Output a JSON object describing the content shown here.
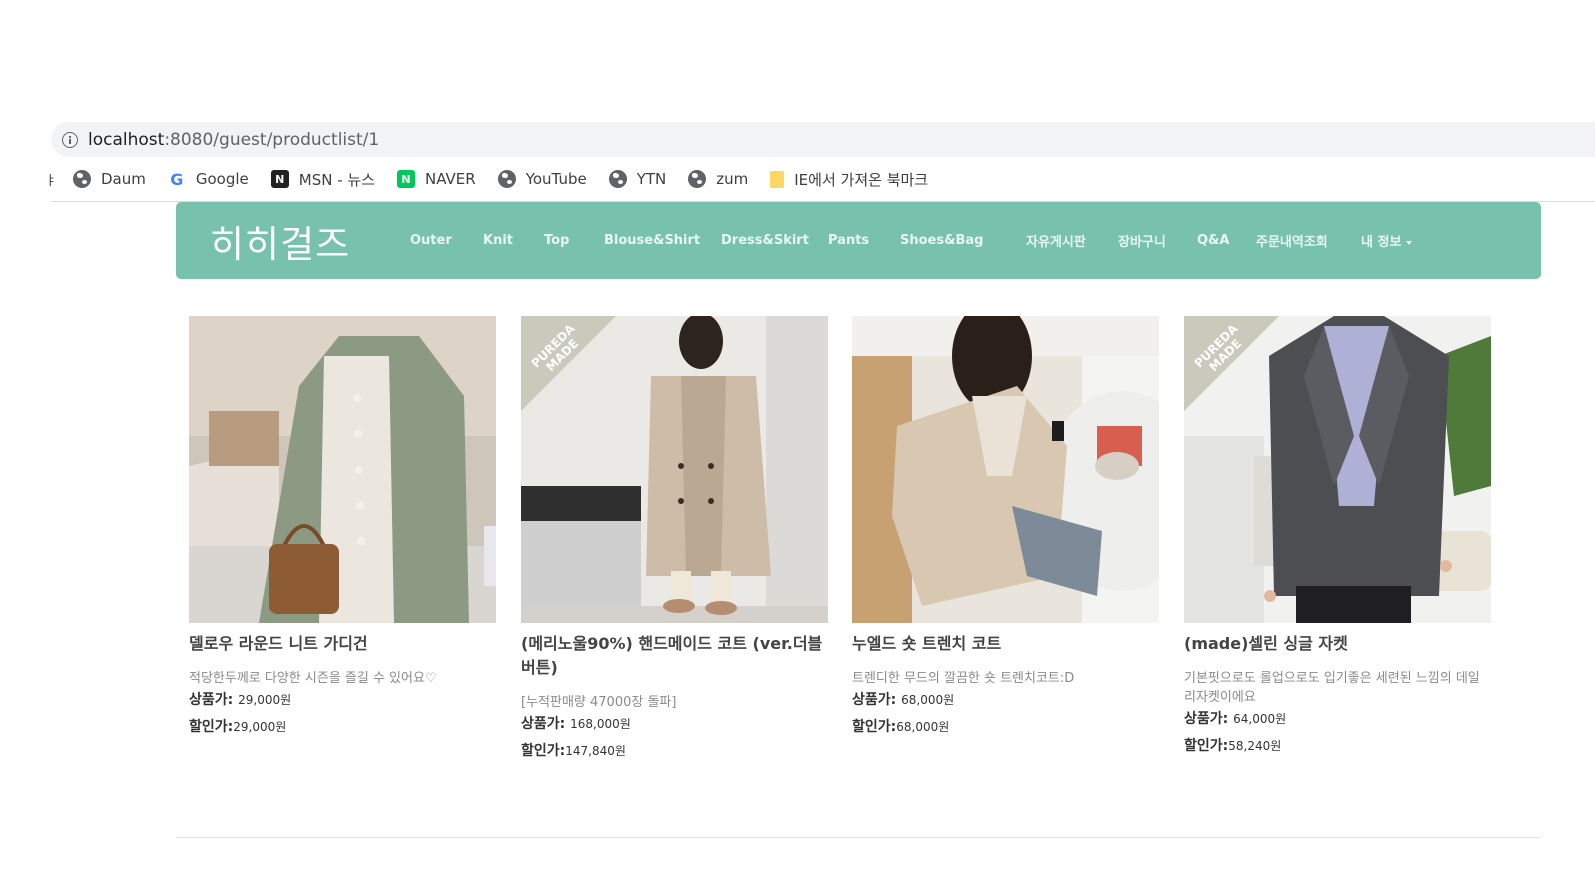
{
  "browser": {
    "url_host": "localhost",
    "url_path": ":8080/guest/productlist/1",
    "bookmarks_leading": "ㅑ",
    "bookmarks": [
      {
        "label": "Daum",
        "icon": "globe-icon"
      },
      {
        "label": "Google",
        "icon": "google-icon"
      },
      {
        "label": "MSN - 뉴스",
        "icon": "msn-icon"
      },
      {
        "label": "NAVER",
        "icon": "naver-icon"
      },
      {
        "label": "YouTube",
        "icon": "globe-icon"
      },
      {
        "label": "YTN",
        "icon": "globe-icon"
      },
      {
        "label": "zum",
        "icon": "globe-icon"
      },
      {
        "label": "IE에서 가져온 북마크",
        "icon": "folder-icon"
      }
    ]
  },
  "navbar": {
    "brand": "히히걸즈",
    "color": "#78c2ad",
    "categories": [
      "Outer",
      "Knit",
      "Top",
      "Blouse&Shirt",
      "Dress&Skirt",
      "Pants",
      "Shoes&Bag"
    ],
    "menus": [
      "자유게시판",
      "장바구니",
      "Q&A",
      "주문내역조회",
      "내 정보"
    ]
  },
  "products": [
    {
      "name": "델로우 라운드 니트 가디건",
      "desc": "적당한두께로 다양한 시즌을 즐길 수 있어요♡",
      "price_label": "상품가:",
      "price": "29,000원",
      "sale_label": "할인가:",
      "sale": "29,000원",
      "image": "green-cardigan-photo"
    },
    {
      "name": "(메리노울90%) 핸드메이드 코트 (ver.더블 버튼)",
      "desc": "[누적판매량 47000장 돌파]",
      "price_label": "상품가:",
      "price": "168,000원",
      "sale_label": "할인가:",
      "sale": "147,840원",
      "image": "beige-coat-photo",
      "ribbon": "PUREDA MADE"
    },
    {
      "name": "누엘드 숏 트렌치 코트",
      "desc": "트렌디한 무드의 깔끔한 숏 트렌치코트:D",
      "price_label": "상품가:",
      "price": "68,000원",
      "sale_label": "할인가:",
      "sale": "68,000원",
      "image": "trench-coat-photo"
    },
    {
      "name": "(made)셀린 싱글 자켓",
      "desc": "기본핏으로도 롤업으로도 입기좋은 세련된 느낌의 데일리자켓이에요",
      "price_label": "상품가:",
      "price": "64,000원",
      "sale_label": "할인가:",
      "sale": "58,240원",
      "image": "gray-jacket-photo",
      "ribbon": "PUREDA MADE"
    }
  ]
}
